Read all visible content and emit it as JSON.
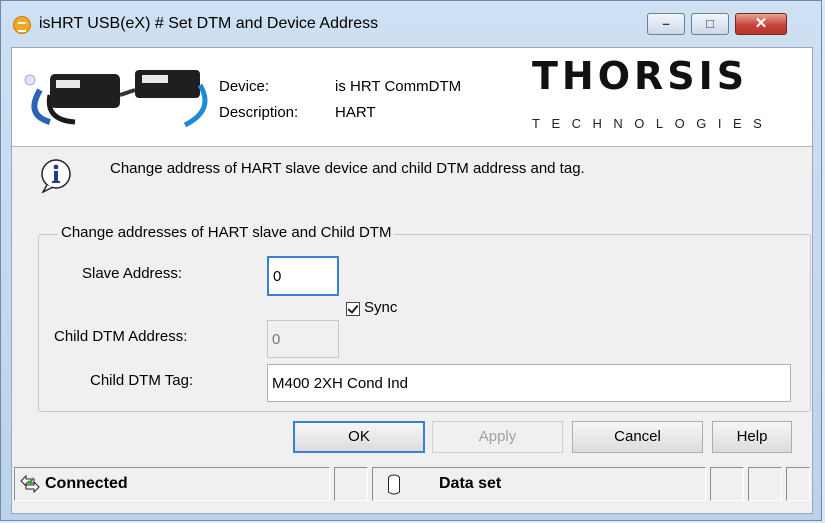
{
  "window": {
    "title": "isHRT USB(eX) # Set DTM and Device Address",
    "controls": {
      "minimize": "–",
      "maximize": "□",
      "close": "✕"
    }
  },
  "header": {
    "device_label": "Device:",
    "device_value": "is HRT CommDTM",
    "description_label": "Description:",
    "description_value": "HART",
    "logo_main": "THORSIS",
    "logo_sub": "TECHNOLOGIES"
  },
  "info": {
    "message": "Change address of HART slave device and child DTM address and tag."
  },
  "group": {
    "title": "Change addresses of HART slave and Child DTM",
    "slave_address_label": "Slave Address:",
    "slave_address_value": "0",
    "sync_label": "Sync",
    "sync_checked": true,
    "child_dtm_address_label": "Child DTM Address:",
    "child_dtm_address_value": "0",
    "child_dtm_tag_label": "Child DTM Tag:",
    "child_dtm_tag_value": "M400 2XH Cond Ind"
  },
  "buttons": {
    "ok": "OK",
    "apply": "Apply",
    "cancel": "Cancel",
    "help": "Help"
  },
  "status": {
    "connection": "Connected",
    "data": "Data set"
  },
  "colors": {
    "accent": "#3c7fd1",
    "logo_orange": "#f5a623",
    "close_red": "#c7443a"
  }
}
